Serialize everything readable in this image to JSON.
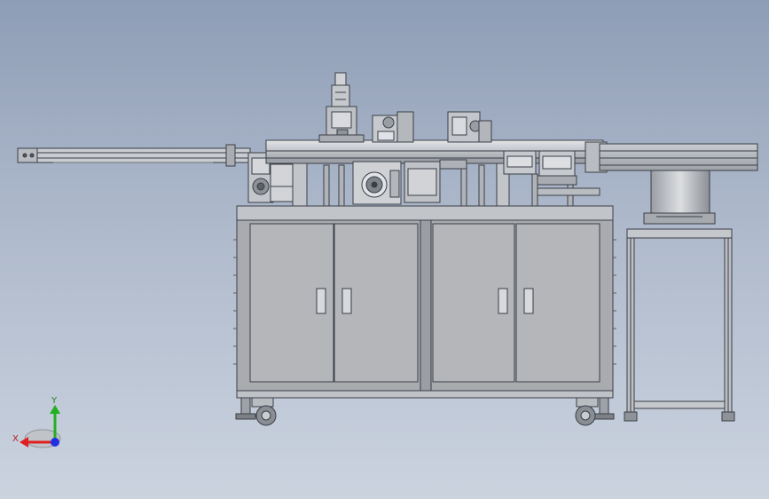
{
  "viewport": {
    "background_top": "#8e9db6",
    "background_bottom": "#cbd3df"
  },
  "triad": {
    "x_label": "X",
    "y_label": "Y",
    "x_color": "#e02020",
    "y_color": "#20b020",
    "z_color": "#2030e0"
  },
  "colors": {
    "line": "#3a3f47",
    "cabinet": "#a9abaf",
    "door": "#b4b6ba",
    "metal_light": "#d6d8db",
    "metal_mid": "#bfc2c6",
    "metal_dark": "#8f9399",
    "shadow": "#6d7178"
  }
}
